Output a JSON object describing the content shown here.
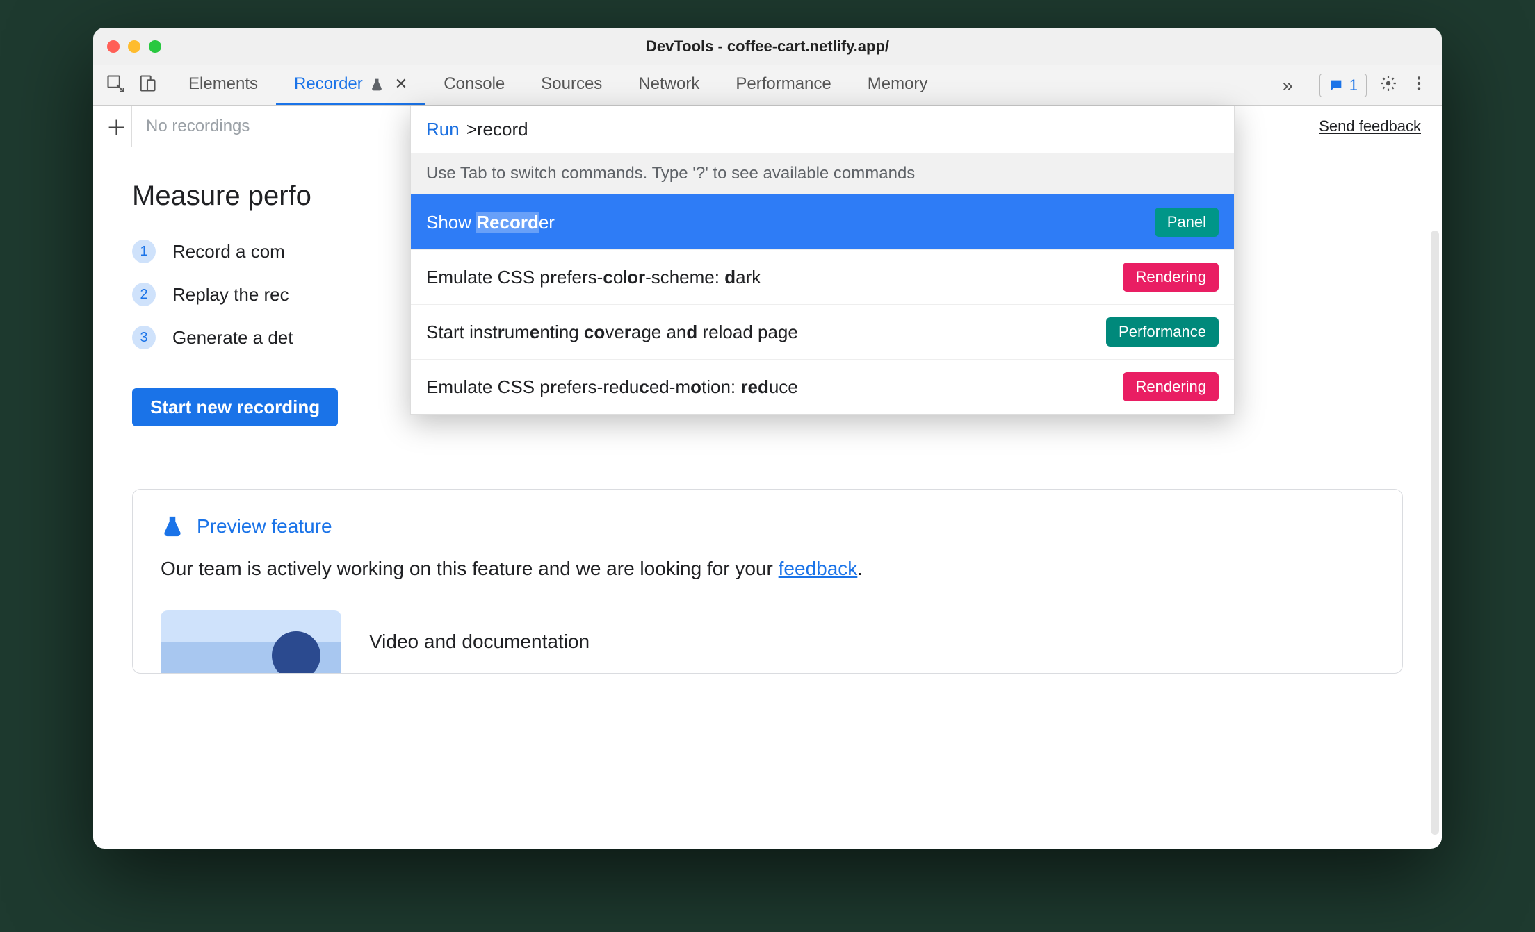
{
  "window": {
    "title": "DevTools - coffee-cart.netlify.app/"
  },
  "tabs": {
    "items": [
      {
        "label": "Elements"
      },
      {
        "label": "Recorder"
      },
      {
        "label": "Console"
      },
      {
        "label": "Sources"
      },
      {
        "label": "Network"
      },
      {
        "label": "Performance"
      },
      {
        "label": "Memory"
      }
    ],
    "active_index": 1,
    "messages_count": "1"
  },
  "subbar": {
    "placeholder": "No recordings",
    "feedback": "Send feedback"
  },
  "main": {
    "heading": "Measure perfo",
    "steps": [
      {
        "num": "1",
        "text": "Record a com"
      },
      {
        "num": "2",
        "text": "Replay the rec"
      },
      {
        "num": "3",
        "text": "Generate a det"
      }
    ],
    "start_button": "Start new recording"
  },
  "preview": {
    "label": "Preview feature",
    "text_prefix": "Our team is actively working on this feature and we are looking for your ",
    "text_link": "feedback",
    "text_suffix": ".",
    "video_title": "Video and documentation"
  },
  "palette": {
    "run_label": "Run",
    "query_prefix": ">",
    "query": "record",
    "hint": "Use Tab to switch commands. Type '?' to see available commands",
    "items": [
      {
        "label_parts": [
          "Show ",
          "Record",
          "er"
        ],
        "badge": "Panel",
        "badge_kind": "panel",
        "selected": true
      },
      {
        "label_parts": [
          "Emulate CSS p",
          "r",
          "efers-",
          "c",
          "ol",
          "or",
          "-scheme: ",
          "d",
          "ark"
        ],
        "badge": "Rendering",
        "badge_kind": "rendering",
        "selected": false
      },
      {
        "label_parts": [
          "Start inst",
          "r",
          "um",
          "e",
          "nting ",
          "co",
          "ve",
          "r",
          "age an",
          "d",
          " reload page"
        ],
        "badge": "Performance",
        "badge_kind": "performance",
        "selected": false
      },
      {
        "label_parts": [
          "Emulate CSS p",
          "r",
          "efers-redu",
          "c",
          "ed-m",
          "o",
          "tion: ",
          "red",
          "uce"
        ],
        "badge": "Rendering",
        "badge_kind": "rendering",
        "selected": false
      }
    ]
  }
}
